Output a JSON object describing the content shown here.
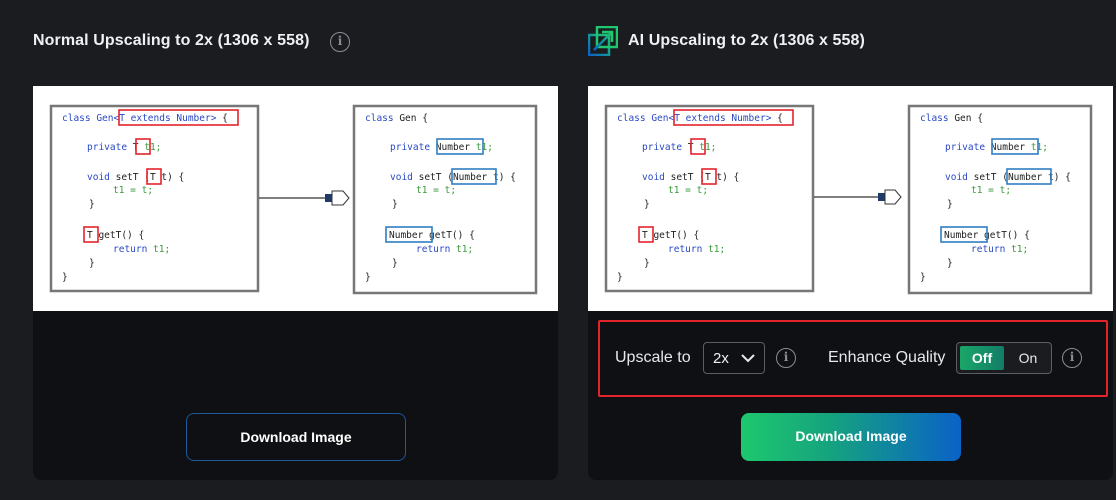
{
  "left_panel": {
    "title": "Normal Upscaling to 2x (1306 x 558)",
    "info_icon": "info-icon",
    "download_label": "Download Image"
  },
  "right_panel": {
    "title": "AI Upscaling to 2x (1306 x 558)",
    "ai_icon": "ai-upscale-icon",
    "download_label": "Download Image",
    "controls": {
      "upscale_label": "Upscale to",
      "upscale_value": "2x",
      "enhance_label": "Enhance Quality",
      "toggle_off_label": "Off",
      "toggle_on_label": "On",
      "toggle_state": "Off"
    }
  },
  "code_preview": {
    "before": {
      "line1_prefix": "class Gen",
      "line1_generic": "<T extends Number>",
      "line1_suffix": " {",
      "line2_kw": "private",
      "line2_type": "T",
      "line2_var": " t1;",
      "line3_kw": "void",
      "line3_name": " setT (",
      "line3_type": "T",
      "line3_rest": " t) {",
      "line4": "t1 = t;",
      "line5": "}",
      "line6_type": "T",
      "line6_rest": " getT() {",
      "line7_kw": "return",
      "line7_var": " t1;",
      "line8": "}",
      "line9": "}"
    },
    "after": {
      "line1_kw": "class",
      "line1_rest": " Gen {",
      "line2_kw": "private",
      "line2_type": "Number",
      "line2_var": " t1;",
      "line3_kw": "void",
      "line3_name": " setT (",
      "line3_type": "Number",
      "line3_rest": " t) {",
      "line4": "t1 = t;",
      "line5": "}",
      "line6_type": "Number",
      "line6_rest": " getT() {",
      "line7_kw": "return",
      "line7_var": " t1;",
      "line8": "}",
      "line9": "}"
    }
  },
  "colors": {
    "accent_green": "#1ec86e",
    "accent_blue": "#0a62c7",
    "highlight_red": "#e3252b",
    "code_blue": "#2a49c4",
    "code_green": "#3a9a3a"
  }
}
